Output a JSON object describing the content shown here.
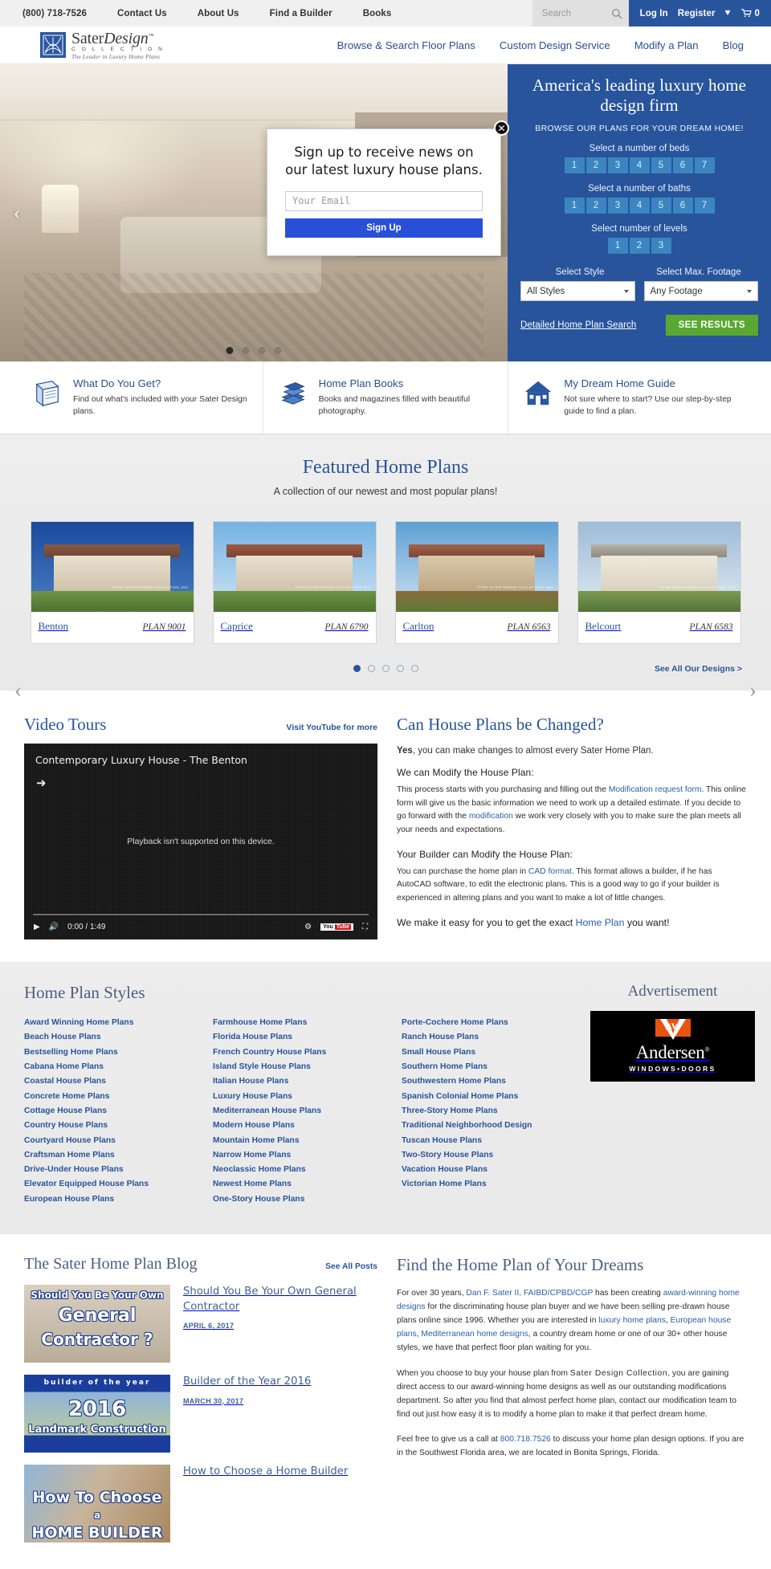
{
  "utility": {
    "phone": "(800) 718-7526",
    "links": [
      "Contact Us",
      "About Us",
      "Find a Builder",
      "Books"
    ],
    "search_placeholder": "Search",
    "search_value": "",
    "login": "Log In",
    "register": "Register",
    "cart_count": "0"
  },
  "brand": {
    "name_a": "Sater",
    "name_b": "Design",
    "tm": "™",
    "collection": "C O L L E C T I O N",
    "tagline": "The Leader in Luxury Home Plans"
  },
  "mainnav": [
    "Browse & Search Floor Plans",
    "Custom Design Service",
    "Modify a Plan",
    "Blog"
  ],
  "hero": {
    "headline": "America's leading luxury home design firm",
    "tagline": "BROWSE OUR PLANS FOR YOUR DREAM HOME!",
    "beds_label": "Select a number of beds",
    "beds": [
      "1",
      "2",
      "3",
      "4",
      "5",
      "6",
      "7"
    ],
    "baths_label": "Select a number of baths",
    "baths": [
      "1",
      "2",
      "3",
      "4",
      "5",
      "6",
      "7"
    ],
    "levels_label": "Select number of levels",
    "levels": [
      "1",
      "2",
      "3"
    ],
    "style_label": "Select Style",
    "style_value": "All Styles",
    "footage_label": "Select Max. Footage",
    "footage_value": "Any Footage",
    "detailed_link": "Detailed Home Plan Search",
    "see_results": "SEE RESULTS",
    "prev_arrow": "‹",
    "next_arrow": "›",
    "accent": "#27549b",
    "button_green": "#5aa832"
  },
  "modal": {
    "heading": "Sign up to receive news on our latest luxury house plans.",
    "email_placeholder": "Your Email",
    "email_value": "",
    "button": "Sign Up",
    "close": "✕"
  },
  "features": [
    {
      "icon": "blueprint-icon",
      "title": "What Do You Get?",
      "text": "Find out what's included with your Sater Design plans."
    },
    {
      "icon": "books-icon",
      "title": "Home Plan Books",
      "text": "Books and magazines filled with beautiful photography."
    },
    {
      "icon": "house-icon",
      "title": "My Dream Home Guide",
      "text": "Not sure where to start? Use our step-by-step guide to find a plan."
    }
  ],
  "featured": {
    "title": "Featured Home Plans",
    "subtitle": "A collection of our newest and most popular plans!",
    "watermark": "©THE SATER DESIGN COLLECTION, INC.",
    "plans": [
      {
        "name": "Benton",
        "number": "PLAN 9001",
        "sky": "#1c4a9e"
      },
      {
        "name": "Caprice",
        "number": "PLAN 6790",
        "sky": "#7fb8e0"
      },
      {
        "name": "Carlton",
        "number": "PLAN 6563",
        "sky": "#6fa9d9"
      },
      {
        "name": "Belcourt",
        "number": "PLAN 6583",
        "sky": "#a9c5de"
      }
    ],
    "dots": 5,
    "active_dot": 0,
    "see_all": "See All Our Designs >",
    "prev": "‹",
    "next": "›"
  },
  "video": {
    "section_title": "Video Tours",
    "youtube_link": "Visit YouTube for more",
    "title": "Contemporary Luxury House - The Benton",
    "message": "Playback isn't supported on this device.",
    "time": "0:00 / 1:49",
    "yt_badge_a": "You",
    "yt_badge_b": "Tube"
  },
  "faq": {
    "title": "Can House Plans be Changed?",
    "lead_strong": "Yes",
    "lead_rest": ", you can make changes to almost every Sater Home Plan.",
    "sub1": "We can Modify the House Plan:",
    "body1_a": "This process starts with you purchasing and filling out the ",
    "body1_link1": "Modification request form",
    "body1_b": ". This online form will give us the basic information we need to work up a detailed estimate. If you decide to go forward with the ",
    "body1_link2": "modification",
    "body1_c": " we work very closely with you to make sure the plan meets all your needs and expectations.",
    "sub2": "Your Builder can Modify the House Plan:",
    "body2_a": "You can purchase the home plan in ",
    "body2_link": "CAD format",
    "body2_b": ". This format allows a builder, if he has AutoCAD software, to edit the electronic plans. This is a good way to go if your builder is experienced in altering plans and you want to make a lot of little changes.",
    "final_a": "We make it easy for you to get the exact ",
    "final_link": "Home Plan",
    "final_b": " you want!"
  },
  "styles": {
    "title": "Home Plan Styles",
    "col1": [
      "Award Winning Home Plans",
      "Beach House Plans",
      "Bestselling Home Plans",
      "Cabana Home Plans",
      "Coastal House Plans",
      "Concrete Home Plans",
      "Cottage House Plans",
      "Country House Plans",
      "Courtyard House Plans",
      "Craftsman Home Plans",
      "Drive-Under House Plans",
      "Elevator Equipped House Plans",
      "European House Plans"
    ],
    "col2": [
      "Farmhouse Home Plans",
      "Florida House Plans",
      "French Country House Plans",
      "Island Style House Plans",
      "Italian House Plans",
      "Luxury House Plans",
      "Mediterranean House Plans",
      "Modern House Plans",
      "Mountain Home Plans",
      "Narrow Home Plans",
      "Neoclassic Home Plans",
      "Newest Home Plans",
      "One-Story House Plans"
    ],
    "col3": [
      "Porte-Cochere Home Plans",
      "Ranch House Plans",
      "Small House Plans",
      "Southern Home Plans",
      "Southwestern Home Plans",
      "Spanish Colonial Home Plans",
      "Three-Story Home Plans",
      "Traditional Neighborhood Design",
      "Tuscan House Plans",
      "Two-Story House Plans",
      "Vacation House Plans",
      "Victorian Home Plans"
    ]
  },
  "ad": {
    "title": "Advertisement",
    "brand": "Andersen",
    "registered": "®",
    "sub": "WINDOWS•DOORS",
    "mark": "AW",
    "tm": "TM"
  },
  "blog": {
    "title": "The Sater Home Plan Blog",
    "see_all": "See All Posts",
    "posts": [
      {
        "title": "Should You Be Your Own General Contractor",
        "date": "APRIL 6, 2017",
        "thumb_line1": "Should You Be Your Own",
        "thumb_line2": "General",
        "thumb_line3": "Contractor ?"
      },
      {
        "title": "Builder of the Year 2016",
        "date": "MARCH 30, 2017",
        "thumb_line1": "builder of the year",
        "thumb_line2": "2016",
        "thumb_line3": "Landmark Construction"
      },
      {
        "title": "How to Choose a Home Builder",
        "date": "",
        "thumb_line1": "How To Choose",
        "thumb_line2": "a",
        "thumb_line3": "HOME BUILDER"
      }
    ]
  },
  "dreams": {
    "title": "Find the Home Plan of Your Dreams",
    "p1_a": "For over 30 years, ",
    "p1_link1": "Dan F. Sater II, FAIBD/CPBD/CGP",
    "p1_b": " has been creating ",
    "p1_link2": "award-winning home designs",
    "p1_c": " for the discriminating house plan buyer and we have been selling pre-drawn house plans online since 1996. Whether you are interested in ",
    "p1_link3": "luxury home plans",
    "p1_d": ", ",
    "p1_link4": "European house plans",
    "p1_e": ", ",
    "p1_link5": "Mediterranean home designs",
    "p1_f": ", a country dream home or one of our 30+ other house styles, we have that perfect floor plan waiting for you.",
    "p2_a": "When you choose to buy your house plan from ",
    "p2_brand": "Sater Design Collection",
    "p2_b": ", you are gaining direct access to our award-winning home designs as well as our outstanding modifications department. So after you find that almost perfect home plan, contact our modification team to find out just how easy it is to modify a home plan to make it that perfect dream home.",
    "p3_a": "Feel free to give us a call at ",
    "p3_link": "800.718.7526",
    "p3_b": " to discuss your home plan design options. If you are in the Southwest Florida area, we are located in Bonita Springs, Florida."
  }
}
